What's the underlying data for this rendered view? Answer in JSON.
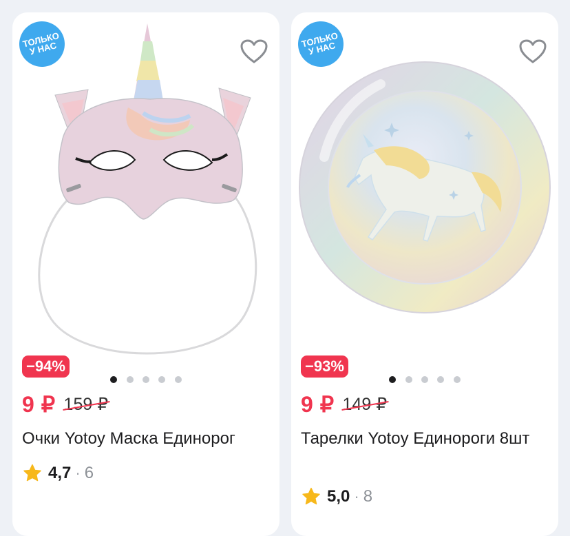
{
  "products": [
    {
      "badge": "ТОЛЬКО У НАС",
      "discount": "−94%",
      "price": "9 ₽",
      "old_price": "159 ₽",
      "title": "Очки Yotoy Маска Единорог",
      "rating": "4,7",
      "reviews": "6",
      "image": "unicode-mask-icon",
      "gallery_active": 1,
      "gallery_count": 5
    },
    {
      "badge": "ТОЛЬКО У НАС",
      "discount": "−93%",
      "price": "9 ₽",
      "old_price": "149 ₽",
      "title": "Тарелки Yotoy Единороги 8шт",
      "rating": "5,0",
      "reviews": "8",
      "image": "unicorn-plate-icon",
      "gallery_active": 1,
      "gallery_count": 5
    }
  ],
  "colors": {
    "accent": "#f0354f",
    "badge": "#3fa9ee",
    "star": "#f7b81b"
  }
}
